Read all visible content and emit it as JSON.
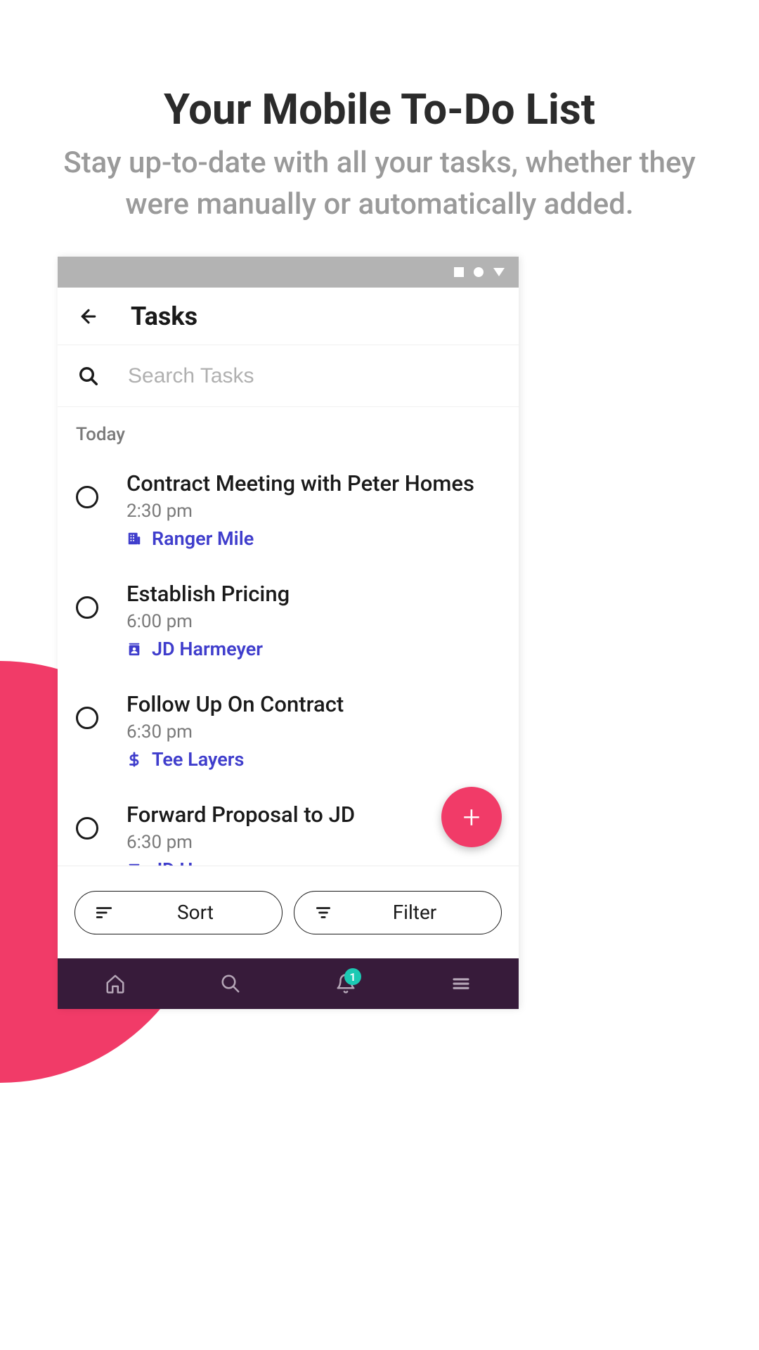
{
  "hero": {
    "title": "Your Mobile To-Do List",
    "subtitle": "Stay up-to-date with all your tasks, whether they were manually or automatically added."
  },
  "app": {
    "title": "Tasks",
    "search_placeholder": "Search Tasks",
    "section_label": "Today",
    "sort_label": "Sort",
    "filter_label": "Filter",
    "badge_count": "1"
  },
  "tasks": [
    {
      "title": "Contract Meeting with Peter Homes",
      "time": "2:30 pm",
      "link_label": "Ranger Mile",
      "link_icon": "building"
    },
    {
      "title": "Establish Pricing",
      "time": "6:00 pm",
      "link_label": "JD Harmeyer",
      "link_icon": "contact"
    },
    {
      "title": "Follow Up On Contract",
      "time": "6:30 pm",
      "link_label": "Tee Layers",
      "link_icon": "dollar"
    },
    {
      "title": "Forward Proposal to JD",
      "time": "6:30 pm",
      "link_label": "JD Harmeyer",
      "link_icon": "contact"
    }
  ]
}
